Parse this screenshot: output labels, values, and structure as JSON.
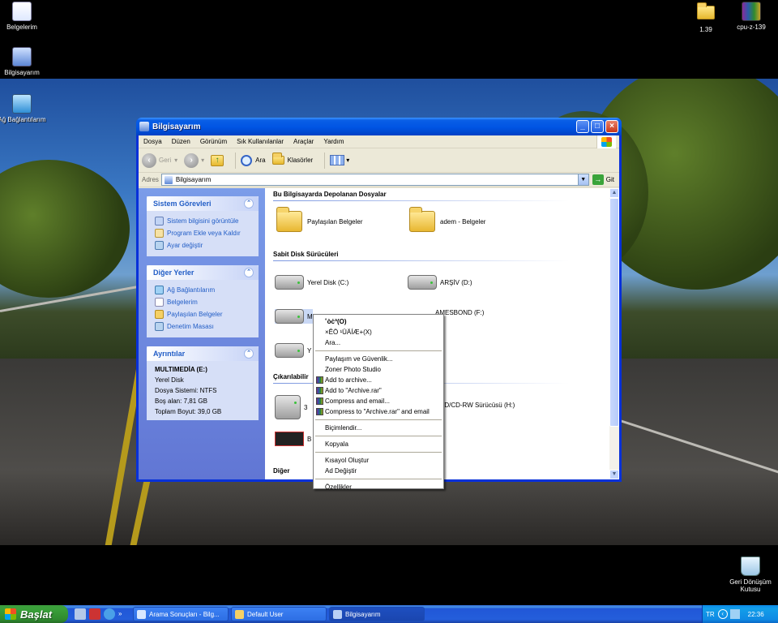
{
  "desktop": {
    "icons_left": [
      {
        "label": "Belgelerim"
      },
      {
        "label": "Bilgisayarım"
      },
      {
        "label": "Ağ Bağlantılarım"
      }
    ],
    "icons_right": [
      {
        "label": "1.39"
      },
      {
        "label": "cpu-z-139"
      }
    ],
    "recycle": {
      "label": "Geri Dönüşüm Kutusu"
    }
  },
  "window": {
    "title": "Bilgisayarım",
    "menu": [
      "Dosya",
      "Düzen",
      "Görünüm",
      "Sık Kullanılanlar",
      "Araçlar",
      "Yardım"
    ],
    "toolbar": {
      "back": "Geri",
      "search": "Ara",
      "folders": "Klasörler"
    },
    "address": {
      "label": "Adres",
      "value": "Bilgisayarım",
      "go": "Git"
    },
    "left": {
      "system_tasks": {
        "title": "Sistem Görevleri",
        "items": [
          "Sistem bilgisini görüntüle",
          "Program Ekle veya Kaldır",
          "Ayar değiştir"
        ]
      },
      "other_places": {
        "title": "Diğer Yerler",
        "items": [
          "Ağ Bağlantılarım",
          "Belgelerim",
          "Paylaşılan Belgeler",
          "Denetim Masası"
        ]
      },
      "details": {
        "title": "Ayrıntılar",
        "name": "MULTIMEDİA (E:)",
        "type": "Yerel Disk",
        "fs": "Dosya Sistemi: NTFS",
        "free": "Boş alan: 7,81 GB",
        "total": "Toplam Boyut: 39,0 GB"
      }
    },
    "content": {
      "sec1": "Bu Bilgisayarda Depolanan Dosyalar",
      "folder1": "Paylaşılan Belgeler",
      "folder2": "adem - Belgeler",
      "sec2": "Sabit Disk Sürücüleri",
      "drive_c": "Yerel Disk (C:)",
      "drive_d": "ARŞİV (D:)",
      "drive_e": "M",
      "drive_f": "AMESBOND (F:)",
      "drive_g": "Y",
      "sec3": "Çıkarılabilir",
      "rem1": "3",
      "dvd": "VD/CD-RW Sürücüsü (H:)",
      "bf": "B",
      "sec4": "Diğer"
    }
  },
  "context_menu": {
    "items": [
      "˚òċª(O)",
      "×ÊÖ ¹ÜÄÍÆ+(X)",
      "Ara...",
      "Paylaşım ve Güvenlik...",
      "Zoner Photo Studio",
      "Add to archive...",
      "Add to \"Archive.rar\"",
      "Compress and email...",
      "Compress to \"Archive.rar\" and email",
      "Biçimlendir...",
      "Kopyala",
      "Kısayol Oluştur",
      "Ad Değiştir",
      "Özellikler"
    ]
  },
  "taskbar": {
    "start": "Başlat",
    "tasks": [
      "Arama Sonuçları - Bilg...",
      "Default User",
      "Bilgisayarım"
    ],
    "lang": "TR",
    "time": "22:36"
  },
  "colors": {
    "accent": "#0054e3",
    "taskbar": "#245edb",
    "start": "#3aa13a"
  }
}
